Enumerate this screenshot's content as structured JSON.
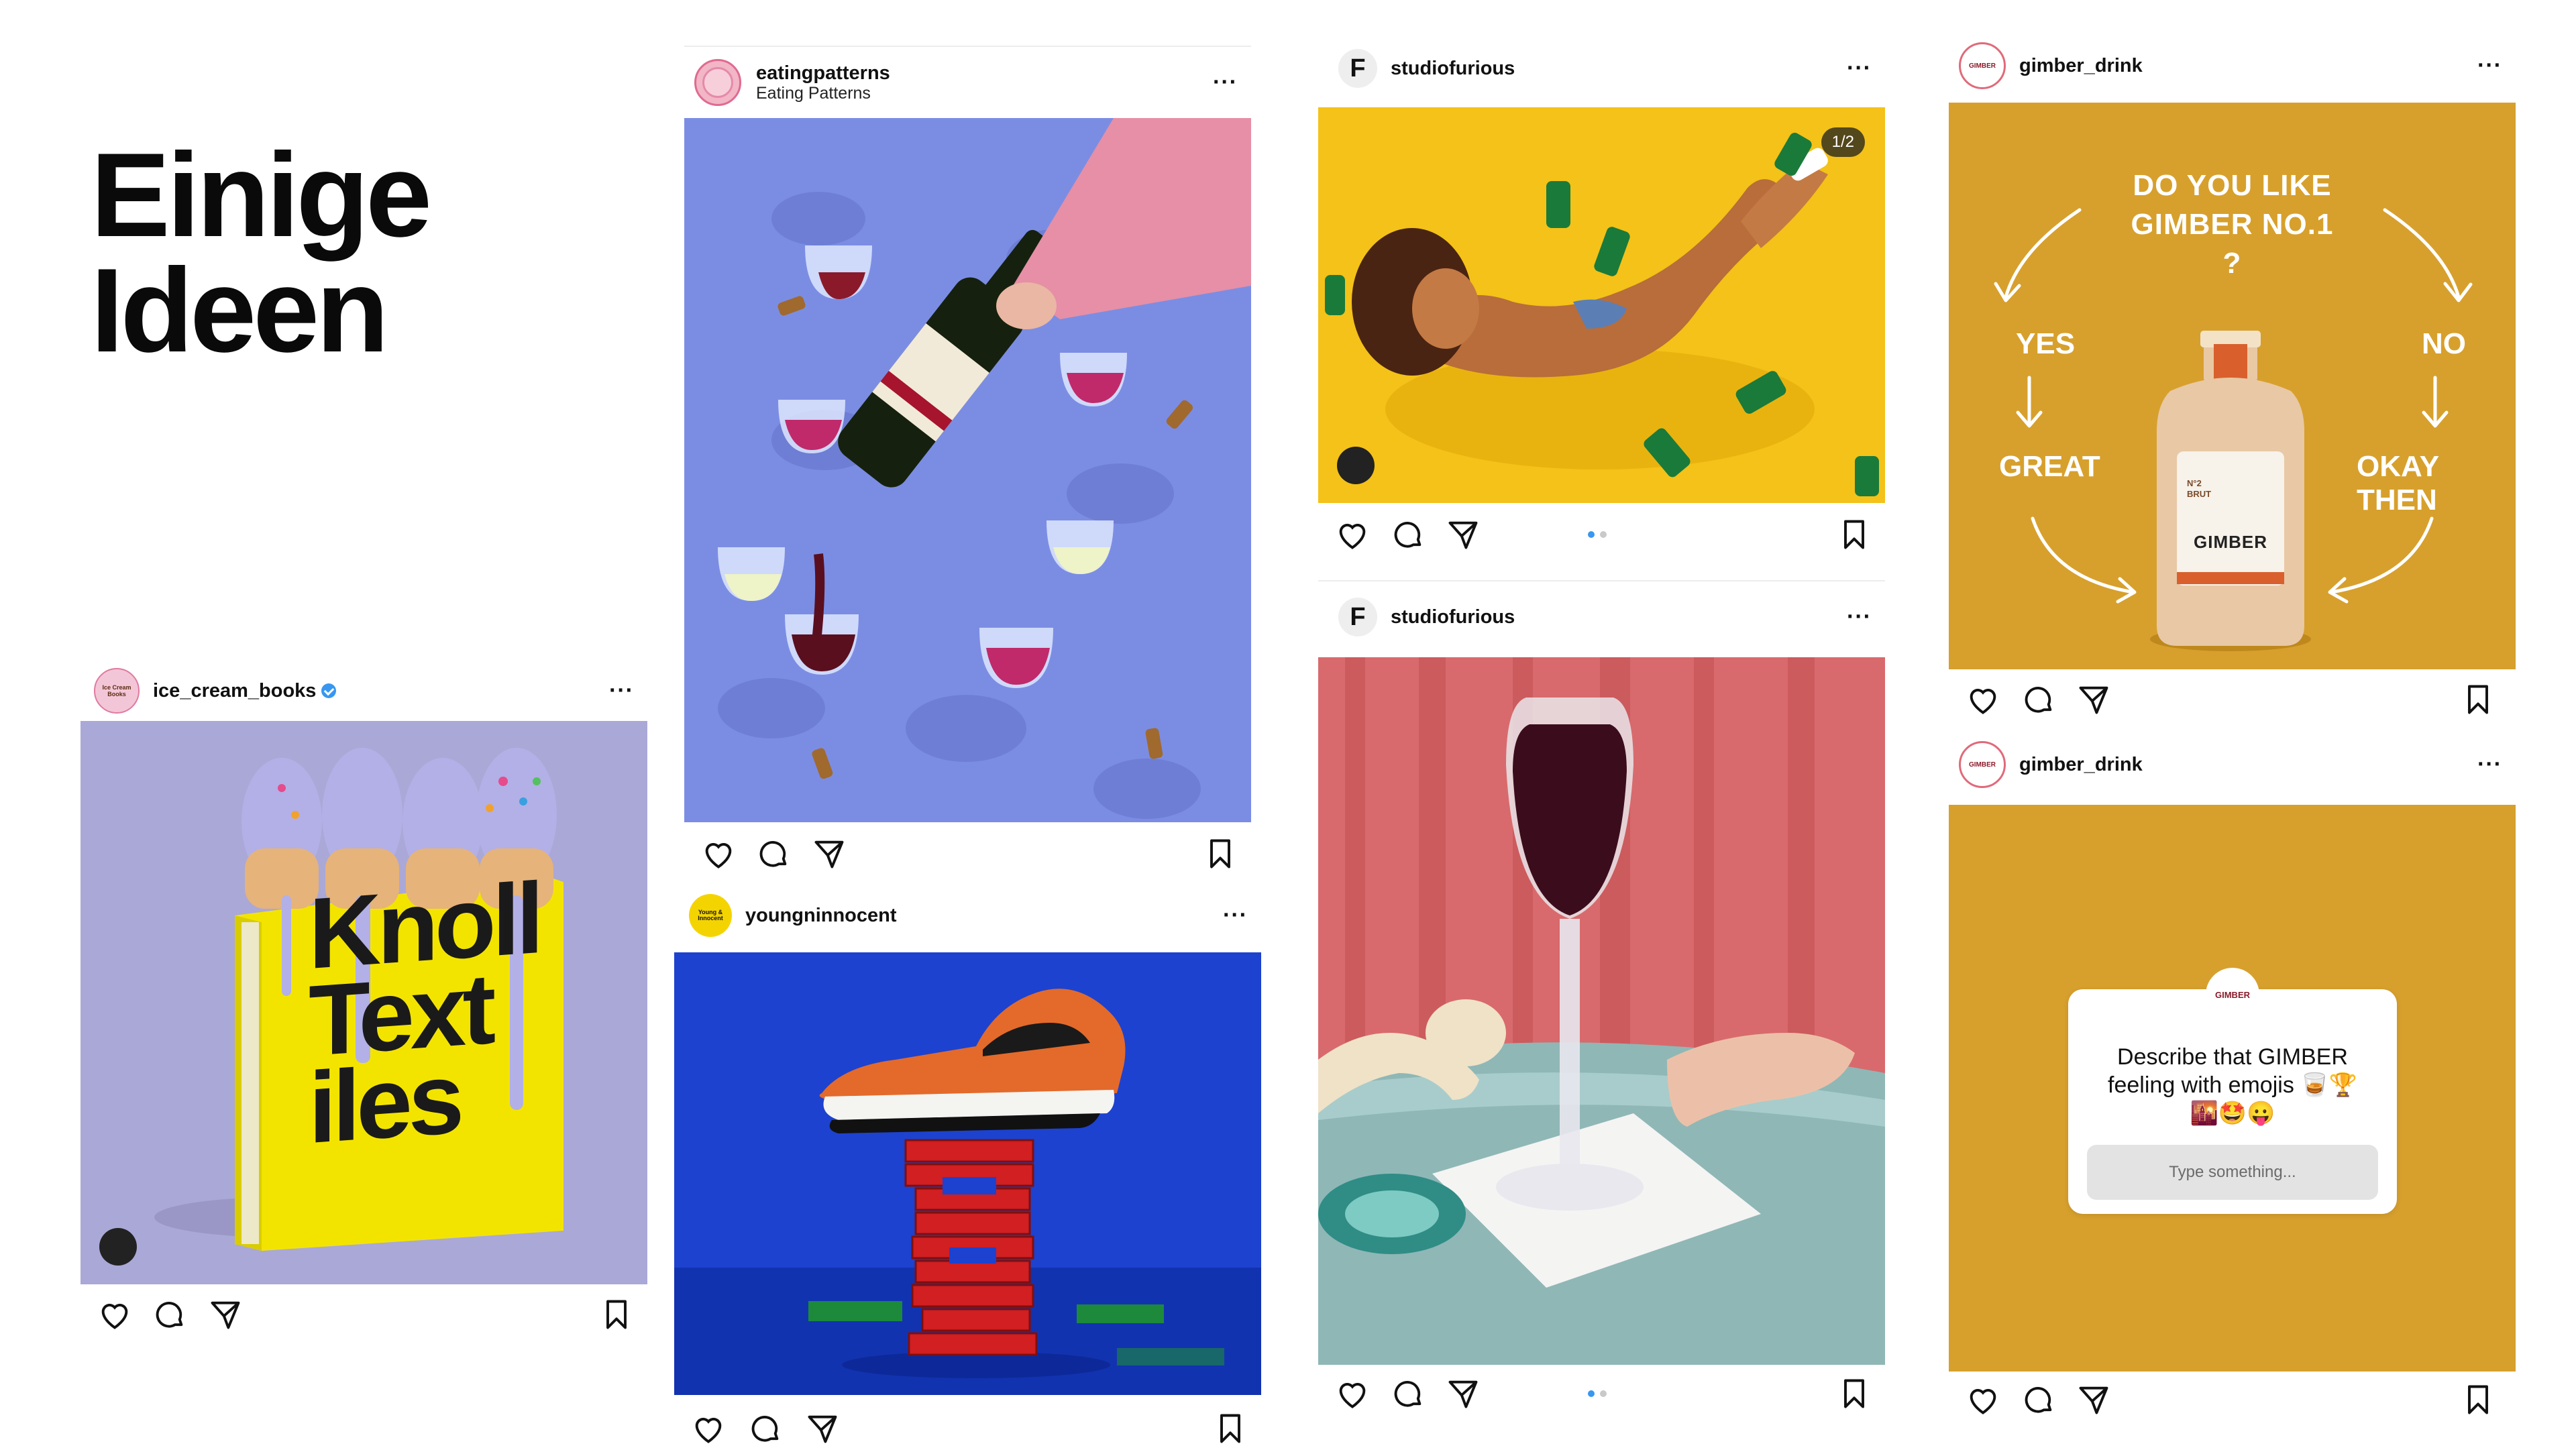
{
  "page": {
    "title_line1": "Einige",
    "title_line2": "Ideen"
  },
  "colors": {
    "accent_blue": "#3897f0",
    "gimber_gold": "#d7a02d",
    "purple_bg": "#a9a7d6",
    "blue_bg": "#7f90e5",
    "yellow_bg": "#f4c218",
    "shoe_blue": "#1a3dc4"
  },
  "icons": {
    "like": "heart-icon",
    "comment": "comment-icon",
    "share": "send-icon",
    "save": "bookmark-icon",
    "more": "more-icon"
  },
  "posts": {
    "ice_cream": {
      "username": "ice_cream_books",
      "avatar_text": "Ice Cream Books",
      "verified": true,
      "more": "···",
      "book_title_1": "Knoll",
      "book_title_2": "Text",
      "book_title_3": "iles"
    },
    "eating": {
      "username": "eatingpatterns",
      "subtitle": "Eating Patterns",
      "more": "···"
    },
    "young": {
      "username": "youngninnocent",
      "avatar_text": "Young & Innocent",
      "more": "···"
    },
    "furious1": {
      "username": "studiofurious",
      "avatar_text": "F",
      "more": "···",
      "counter": "1/2"
    },
    "furious2": {
      "username": "studiofurious",
      "avatar_text": "F",
      "more": "···"
    },
    "gimber1": {
      "username": "gimber_drink",
      "avatar_text": "GIMBER",
      "more": "···",
      "question": "DO YOU LIKE GIMBER NO.1 ?",
      "yes": "YES",
      "no": "NO",
      "great": "GREAT",
      "okay": "OKAY THEN",
      "bottle_brand": "GIMBER",
      "bottle_no": "N°2 BRUT"
    },
    "gimber2": {
      "username": "gimber_drink",
      "avatar_text": "GIMBER",
      "more": "···",
      "sticker_avatar": "GIMBER",
      "sticker_question": "Describe that GIMBER feeling with emojis 🥃🏆 🌇🤩😛",
      "sticker_placeholder": "Type something..."
    }
  }
}
